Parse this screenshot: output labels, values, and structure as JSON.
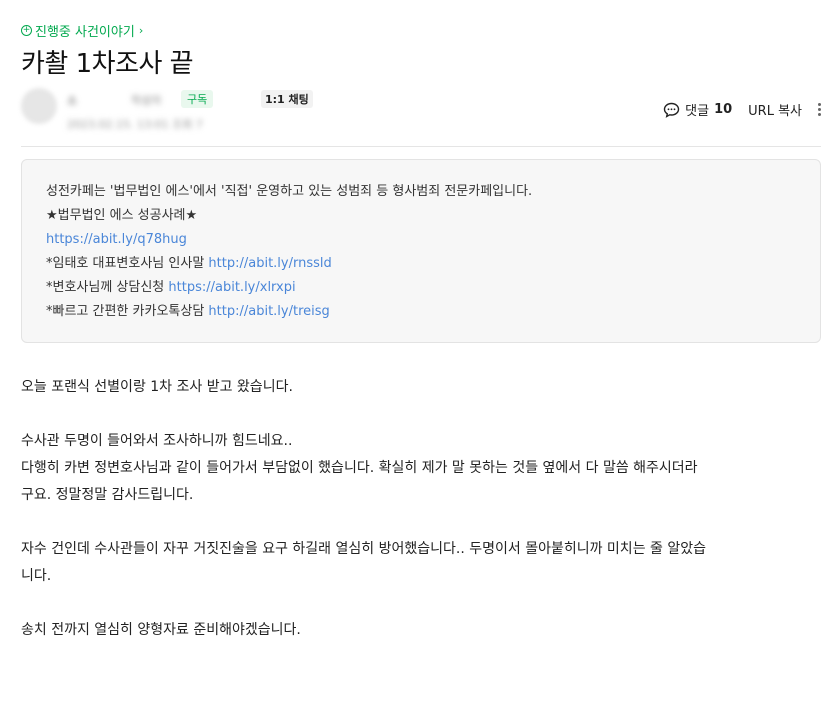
{
  "board": {
    "name": "진행중 사건이야기",
    "chevron": "›"
  },
  "post": {
    "title": "카촬 1차조사 끝"
  },
  "author": {
    "name": "소",
    "grade": "작성자",
    "subscribe_label": "구독",
    "chat_label": "1:1 채팅",
    "date": "2023.02.15. 13:01 조회 7"
  },
  "actions": {
    "comment_label": "댓글",
    "comment_count": "10",
    "url_label": "URL 복사"
  },
  "notice": {
    "line1": "성전카페는 '법무법인 에스'에서 '직접' 운영하고 있는 성범죄 등 형사범죄 전문카페입니다.",
    "line2": "★법무법인 에스 성공사례★",
    "link1": "https://abit.ly/q78hug",
    "line4_text": "*임태호 대표변호사님 인사말 ",
    "link2": "http://abit.ly/rnssld",
    "line5_text": "*변호사님께 상담신청 ",
    "link3": "https://abit.ly/xlrxpi",
    "line6_text": "*빠르고 간편한 카카오톡상담 ",
    "link4": "http://abit.ly/treisg"
  },
  "body": {
    "p1": "오늘 포랜식 선별이랑 1차 조사 받고 왔습니다.",
    "p2": "수사관 두명이 들어와서 조사하니까 힘드네요..",
    "p3a": "다행히 카변 정변호사님과 같이 들어가서 부담없이 했습니다. 확실히 제가 말 못하는 것들 옆에서 다 말씀 해주시더라",
    "p3b": "구요. 정말정말 감사드립니다.",
    "p4a": "자수 건인데 수사관들이 자꾸 거짓진술을 요구 하길래 열심히 방어했습니다.. 두명이서 몰아붙히니까 미치는 줄 알았습",
    "p4b": "니다.",
    "p5": "송치 전까지 열심히 양형자료 준비해야겠습니다."
  },
  "colors": {
    "accent": "#03a94f",
    "link": "#4a86d8"
  }
}
